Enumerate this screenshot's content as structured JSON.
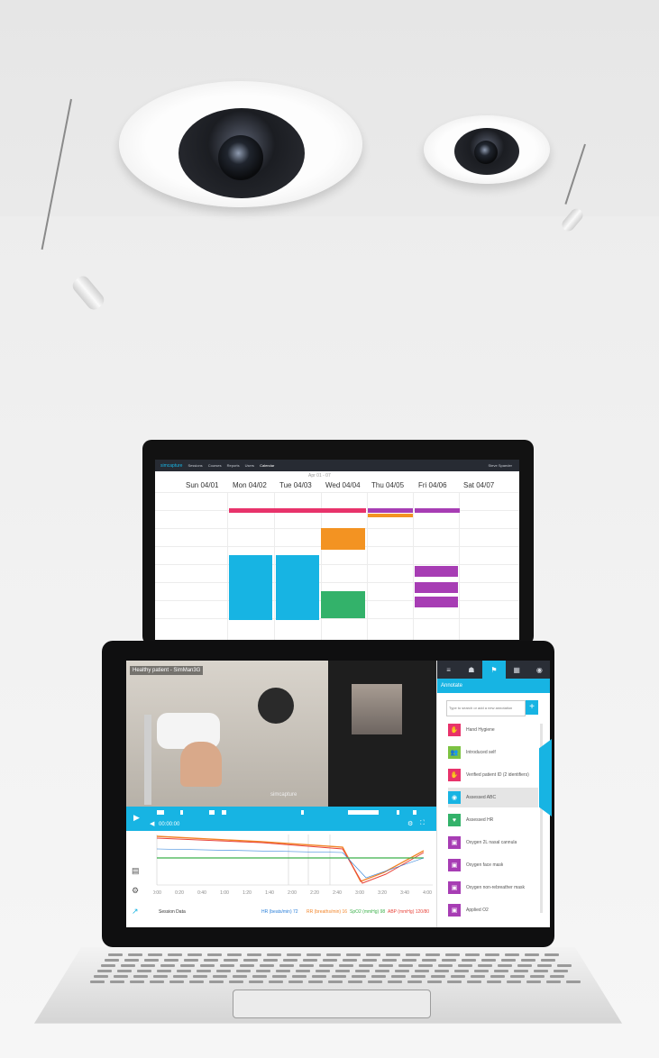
{
  "calendar": {
    "title": "Apr 01 - 07",
    "days": [
      "Sun 04/01",
      "Mon 04/02",
      "Tue 04/03",
      "Wed 04/04",
      "Thu 04/05",
      "Fri 04/06",
      "Sat 04/07"
    ],
    "nav": [
      "simcapture",
      "Sessions",
      "Courses",
      "Reports",
      "Users",
      "Calendar"
    ],
    "user": "Steve Spaeder"
  },
  "player": {
    "title": "Healthy patient - SimMan3G",
    "time": "00:00:00",
    "watermark": "simcapture",
    "timeline_labels": [
      "0:00",
      "0:20",
      "0:40",
      "1:00",
      "1:20",
      "1:40",
      "2:00",
      "2:20",
      "2:40",
      "3:00",
      "3:20",
      "3:40",
      "4:00"
    ]
  },
  "annotations": {
    "header": "Annotate",
    "search_placeholder": "Type to search or add a new annotation",
    "items": [
      {
        "label": "Hand Hygiene",
        "color": "#e8336b",
        "icon": "✋"
      },
      {
        "label": "Introduced self",
        "color": "#7cc242",
        "icon": "👥"
      },
      {
        "label": "Verified patient ID (2 identifiers)",
        "color": "#e8336b",
        "icon": "✋"
      },
      {
        "label": "Assessed ABC",
        "color": "#17b4e3",
        "icon": "◉"
      },
      {
        "label": "Assessed HR",
        "color": "#33b26a",
        "icon": "♥"
      },
      {
        "label": "Oxygen 2L nasal cannula",
        "color": "#a73db4",
        "icon": "▣"
      },
      {
        "label": "Oxygen face mask",
        "color": "#a73db4",
        "icon": "▣"
      },
      {
        "label": "Oxygen non-rebreather mask",
        "color": "#a73db4",
        "icon": "▣"
      },
      {
        "label": "Applied O2",
        "color": "#a73db4",
        "icon": "▣"
      }
    ]
  },
  "legend": {
    "session": "Session Data",
    "items": [
      {
        "label": "HR (beats/min) 72",
        "color": "#2a7fd9"
      },
      {
        "label": "RR (breaths/min) 16",
        "color": "#f2852a"
      },
      {
        "label": "SpO2 (mmHg) 98",
        "color": "#3bb04a"
      },
      {
        "label": "ABP (mmHg) 120/80",
        "color": "#e8433a"
      }
    ]
  },
  "colors": {
    "accent": "#17b4e3",
    "navbar": "#2a2e36"
  }
}
